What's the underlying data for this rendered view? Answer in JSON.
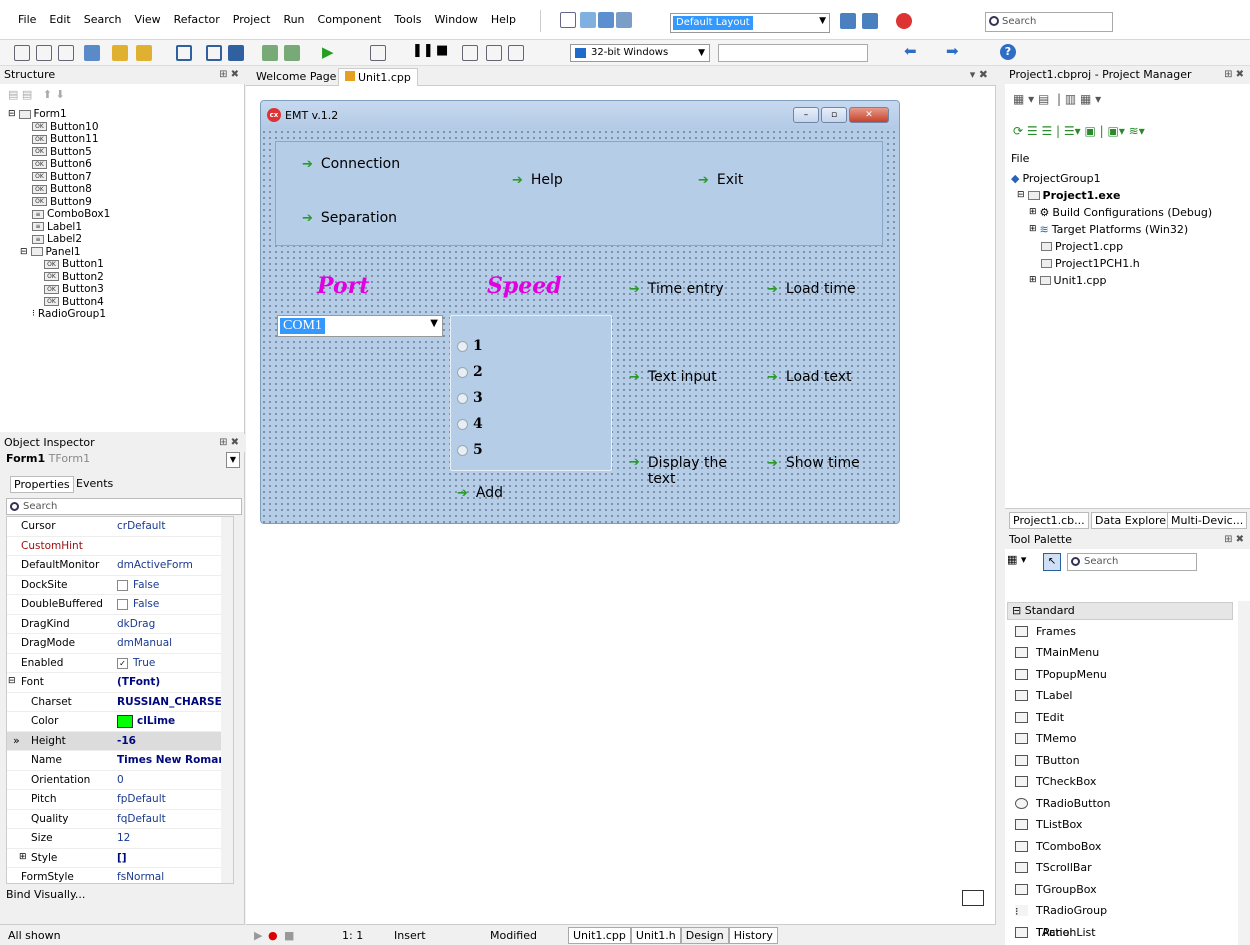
{
  "menu": [
    "File",
    "Edit",
    "Search",
    "View",
    "Refactor",
    "Project",
    "Run",
    "Component",
    "Tools",
    "Window",
    "Help"
  ],
  "layout_combo": "Default Layout",
  "search_placeholder": "Search",
  "platform": "32-bit Windows",
  "structure": {
    "title": "Structure",
    "root": "Form1",
    "items": [
      "Button10",
      "Button11",
      "Button5",
      "Button6",
      "Button7",
      "Button8",
      "Button9",
      "ComboBox1",
      "Label1",
      "Label2",
      "Panel1",
      "Button1",
      "Button2",
      "Button3",
      "Button4",
      "RadioGroup1"
    ]
  },
  "inspector": {
    "title": "Object Inspector",
    "object_name": "Form1",
    "object_type": "TForm1",
    "tab_properties": "Properties",
    "tab_events": "Events",
    "search_placeholder": "Search",
    "bind_visually": "Bind Visually...",
    "all_shown": "All shown",
    "rows": [
      {
        "name": "Cursor",
        "value": "crDefault"
      },
      {
        "name": "CustomHint",
        "value": ""
      },
      {
        "name": "DefaultMonitor",
        "value": "dmActiveForm"
      },
      {
        "name": "DockSite",
        "value": "False"
      },
      {
        "name": "DoubleBuffered",
        "value": "False"
      },
      {
        "name": "DragKind",
        "value": "dkDrag"
      },
      {
        "name": "DragMode",
        "value": "dmManual"
      },
      {
        "name": "Enabled",
        "value": "True"
      },
      {
        "name": "Font",
        "value": "(TFont)"
      },
      {
        "name": "Charset",
        "value": "RUSSIAN_CHARSET"
      },
      {
        "name": "Color",
        "value": "clLime"
      },
      {
        "name": "Height",
        "value": "-16"
      },
      {
        "name": "Name",
        "value": "Times New Roman"
      },
      {
        "name": "Orientation",
        "value": "0"
      },
      {
        "name": "Pitch",
        "value": "fpDefault"
      },
      {
        "name": "Quality",
        "value": "fqDefault"
      },
      {
        "name": "Size",
        "value": "12"
      },
      {
        "name": "Style",
        "value": "[]"
      },
      {
        "name": "FormStyle",
        "value": "fsNormal"
      }
    ]
  },
  "editor": {
    "tab_welcome": "Welcome Page",
    "tab_unit": "Unit1.cpp",
    "form_title": "EMT v.1.2",
    "buttons": {
      "connection": "Connection",
      "separation": "Separation",
      "help": "Help",
      "exit": "Exit",
      "time_entry": "Time entry",
      "load_time": "Load time",
      "text_input": "Text input",
      "load_text": "Load text",
      "display_text": "Display the text",
      "show_time": "Show time",
      "add": "Add"
    },
    "port_label": "Port",
    "speed_label": "Speed",
    "port_value": "COM1",
    "radio_items": [
      "1",
      "2",
      "3",
      "4",
      "5"
    ]
  },
  "status": {
    "position": "1:  1",
    "mode": "Insert",
    "modified": "Modified",
    "tabs": [
      "Unit1.cpp",
      "Unit1.h",
      "Design",
      "History"
    ]
  },
  "project_manager": {
    "title": "Project1.cbproj - Project Manager",
    "file_label": "File",
    "group": "ProjectGroup1",
    "project": "Project1.exe",
    "build_configs": "Build Configurations (Debug)",
    "target_platforms": "Target Platforms (Win32)",
    "files": [
      "Project1.cpp",
      "Project1PCH1.h",
      "Unit1.cpp"
    ],
    "tabs": [
      "Project1.cb...",
      "Data Explorer",
      "Multi-Devic..."
    ]
  },
  "palette": {
    "title": "Tool Palette",
    "search_placeholder": "Search",
    "category": "Standard",
    "items": [
      "Frames",
      "TMainMenu",
      "TPopupMenu",
      "TLabel",
      "TEdit",
      "TMemo",
      "TButton",
      "TCheckBox",
      "TRadioButton",
      "TListBox",
      "TComboBox",
      "TScrollBar",
      "TGroupBox",
      "TRadioGroup",
      "TPanel",
      "TActionList"
    ]
  },
  "colors": {
    "accent": "#3399ff",
    "form_bg": "#b6cde8",
    "label_magenta": "#e000e0",
    "arrow_green": "#2a9a2a"
  }
}
